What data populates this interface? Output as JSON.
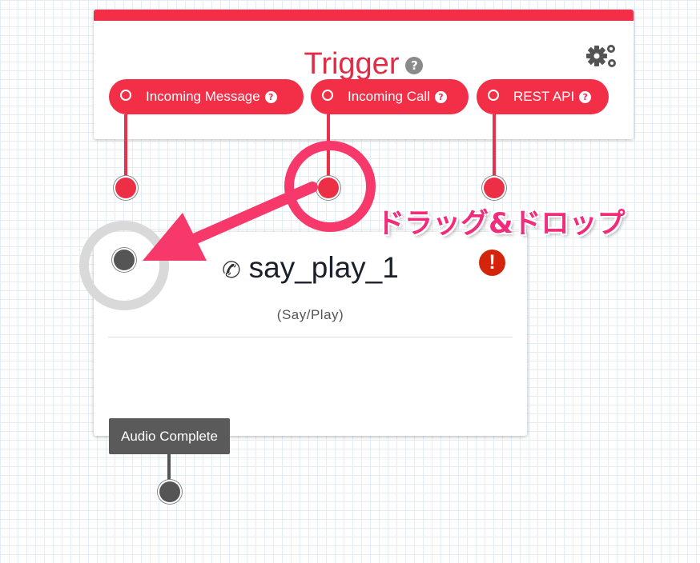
{
  "trigger": {
    "title": "Trigger",
    "help_glyph": "?",
    "settings_icon": "gears-icon",
    "outputs": [
      {
        "label": "Incoming Message",
        "help_glyph": "?"
      },
      {
        "label": "Incoming Call",
        "help_glyph": "?"
      },
      {
        "label": "REST API",
        "help_glyph": "?"
      }
    ],
    "accent_color": "#f22f46"
  },
  "widget": {
    "name": "say_play_1",
    "type": "(Say/Play)",
    "icon": "phone-icon",
    "error_glyph": "!",
    "transitions": [
      {
        "label": "Audio Complete"
      }
    ]
  },
  "annotation": {
    "text": "ドラッグ&ドロップ",
    "color": "#f22c7a"
  }
}
